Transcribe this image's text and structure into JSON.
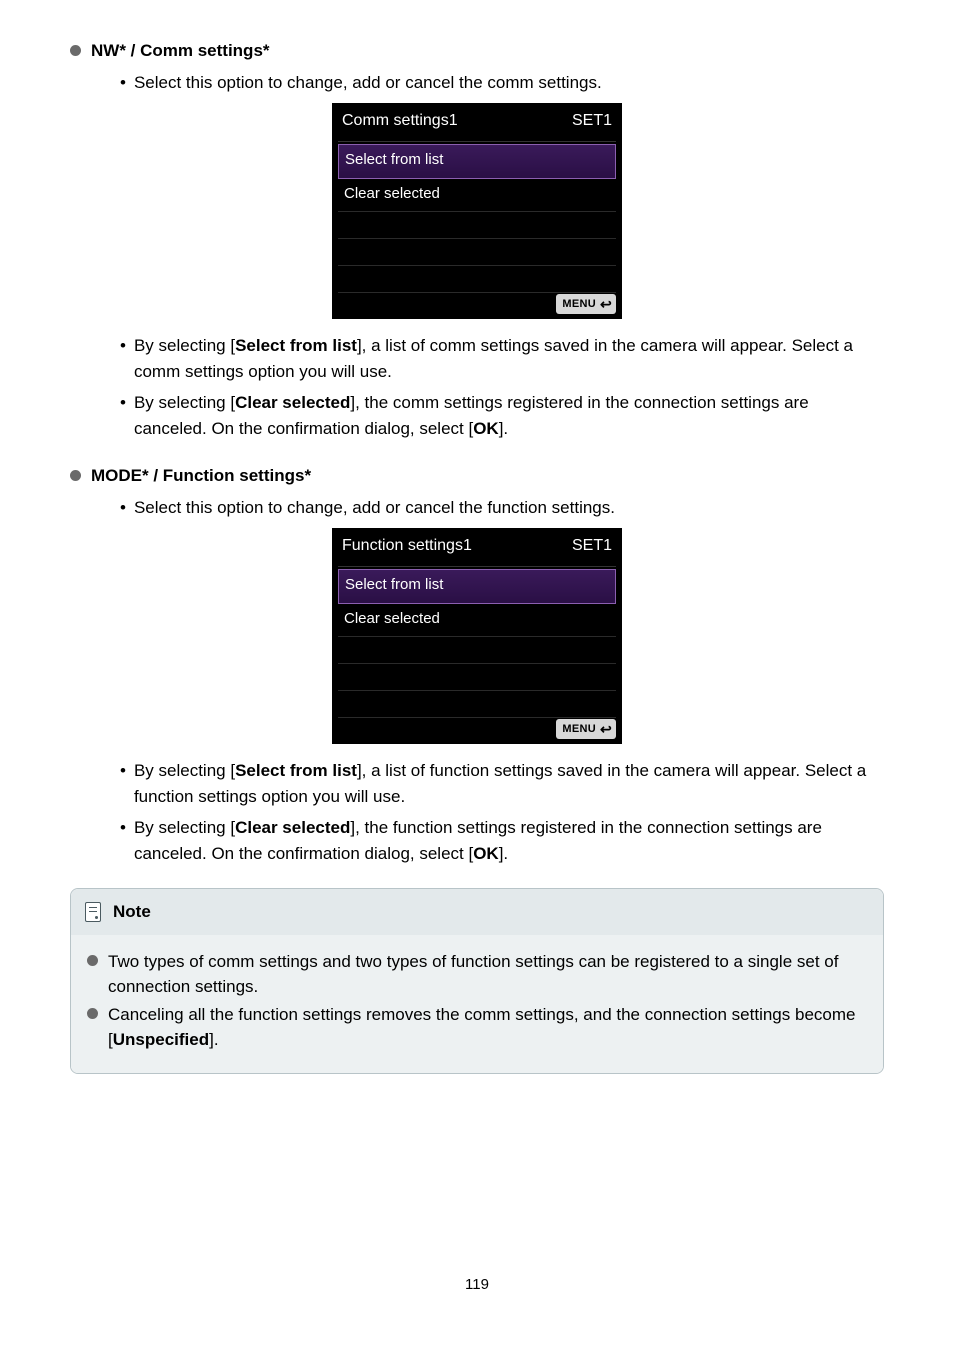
{
  "section1": {
    "title": "NW* / Comm settings*",
    "intro": "Select this option to change, add or cancel the comm settings.",
    "shot": {
      "title": "Comm settings1",
      "set": "SET1",
      "row1": "Select from list",
      "row2": "Clear selected",
      "menu": "MENU"
    },
    "p1_a": "By selecting [",
    "p1_b": "Select from list",
    "p1_c": "], a list of comm settings saved in the camera will appear. Select a comm settings option you will use.",
    "p2_a": "By selecting [",
    "p2_b": "Clear selected",
    "p2_c": "], the comm settings registered in the connection settings are canceled. On the confirmation dialog, select [",
    "p2_d": "OK",
    "p2_e": "]."
  },
  "section2": {
    "title": "MODE* / Function settings*",
    "intro": "Select this option to change, add or cancel the function settings.",
    "shot": {
      "title": "Function settings1",
      "set": "SET1",
      "row1": "Select from list",
      "row2": "Clear selected",
      "menu": "MENU"
    },
    "p1_a": "By selecting [",
    "p1_b": "Select from list",
    "p1_c": "], a list of function settings saved in the camera will appear. Select a function settings option you will use.",
    "p2_a": "By selecting [",
    "p2_b": "Clear selected",
    "p2_c": "], the function settings registered in the connection settings are canceled. On the confirmation dialog, select [",
    "p2_d": "OK",
    "p2_e": "]."
  },
  "note": {
    "label": "Note",
    "item1": "Two types of comm settings and two types of function settings can be registered to a single set of connection settings.",
    "item2_a": "Canceling all the function settings removes the comm settings, and the connection settings become [",
    "item2_b": "Unspecified",
    "item2_c": "]."
  },
  "page": "119"
}
